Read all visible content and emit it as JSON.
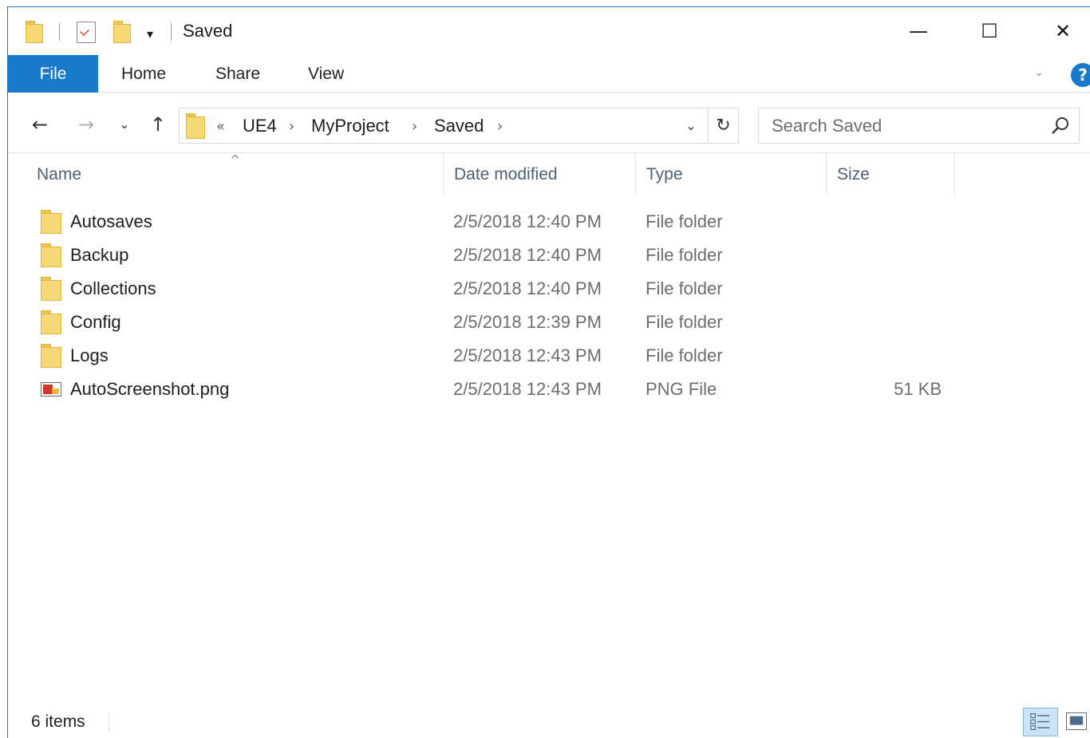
{
  "titlebar": {
    "title": "Saved",
    "qa_dropdown": "▾",
    "minimize": "—",
    "maximize": "☐",
    "close": "✕"
  },
  "ribbon": {
    "tabs": [
      {
        "label": "File"
      },
      {
        "label": "Home"
      },
      {
        "label": "Share"
      },
      {
        "label": "View"
      }
    ],
    "help": "?"
  },
  "navbar": {
    "back": "←",
    "forward": "→",
    "recent": "⌄",
    "up": "↑",
    "breadcrumbs": [
      {
        "label": "UE4"
      },
      {
        "label": "MyProject"
      },
      {
        "label": "Saved"
      }
    ],
    "overflow": "«",
    "crumb_sep": "›",
    "address_dropdown": "⌄",
    "refresh": "↻",
    "search_placeholder": "Search Saved"
  },
  "columns": {
    "name": "Name",
    "date": "Date modified",
    "type": "Type",
    "size": "Size",
    "sort_caret": "^"
  },
  "files": [
    {
      "name": "Autosaves",
      "date": "2/5/2018 12:40 PM",
      "type": "File folder",
      "size": "",
      "icon": "folder-icon"
    },
    {
      "name": "Backup",
      "date": "2/5/2018 12:40 PM",
      "type": "File folder",
      "size": "",
      "icon": "folder-icon"
    },
    {
      "name": "Collections",
      "date": "2/5/2018 12:40 PM",
      "type": "File folder",
      "size": "",
      "icon": "folder-icon"
    },
    {
      "name": "Config",
      "date": "2/5/2018 12:39 PM",
      "type": "File folder",
      "size": "",
      "icon": "folder-icon"
    },
    {
      "name": "Logs",
      "date": "2/5/2018 12:43 PM",
      "type": "File folder",
      "size": "",
      "icon": "folder-icon"
    },
    {
      "name": "AutoScreenshot.png",
      "date": "2/5/2018 12:43 PM",
      "type": "PNG File",
      "size": "51 KB",
      "icon": "png-file-icon"
    }
  ],
  "status": {
    "count": "6 items"
  },
  "colors": {
    "accent": "#1979ca",
    "folder": "#f8d775",
    "header_text": "#4c607a",
    "secondary_text": "#6d6d6d"
  }
}
